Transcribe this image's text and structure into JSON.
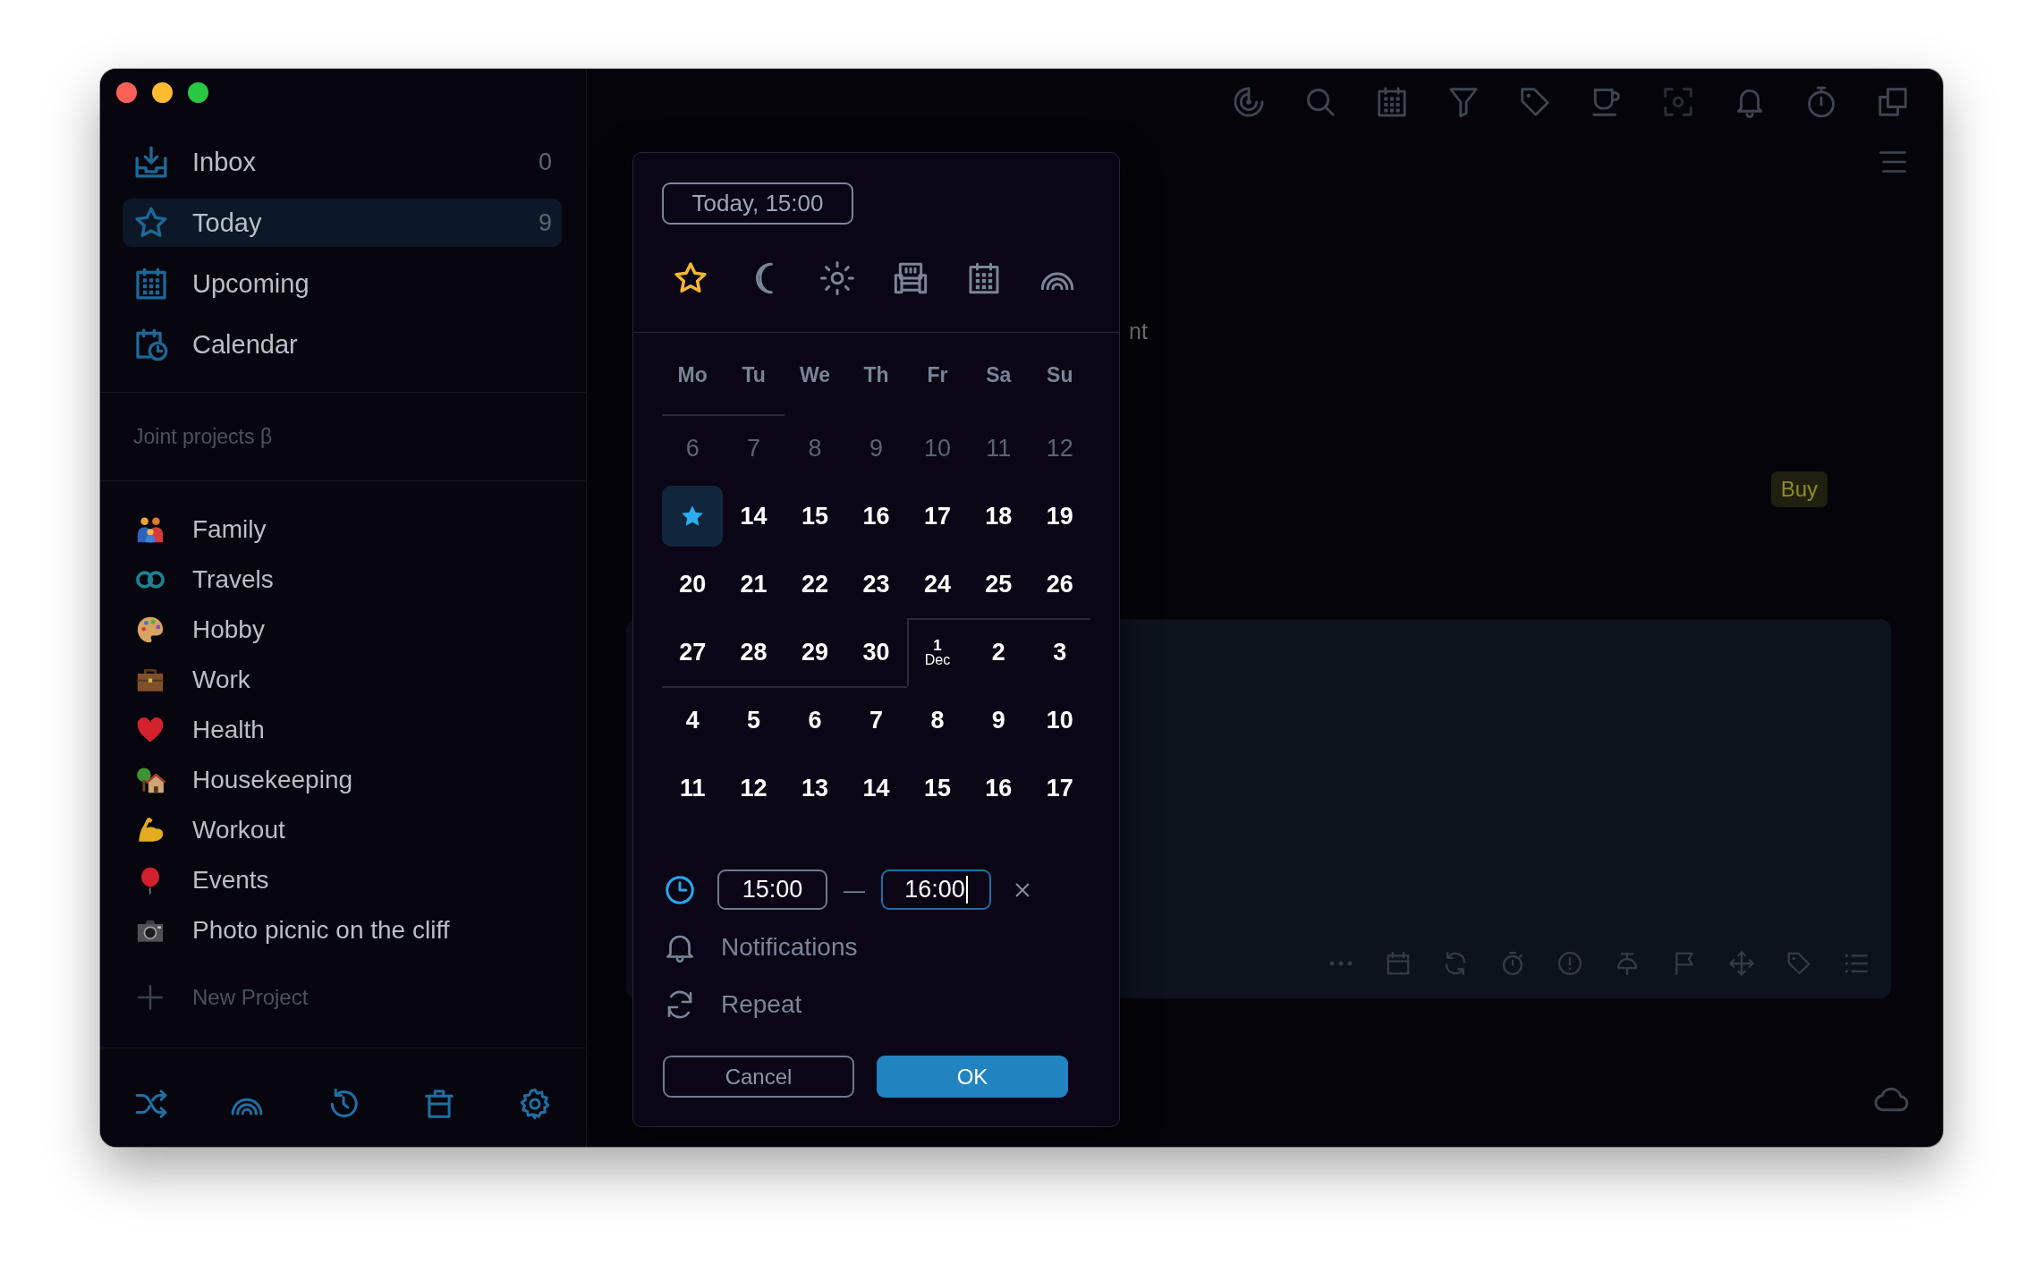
{
  "sidebar": {
    "nav": [
      {
        "label": "Inbox",
        "count": "0",
        "selected": false
      },
      {
        "label": "Today",
        "count": "9",
        "selected": true
      },
      {
        "label": "Upcoming",
        "selected": false
      },
      {
        "label": "Calendar",
        "selected": false
      }
    ],
    "section_title": "Joint projects β",
    "projects": [
      {
        "label": "Family"
      },
      {
        "label": "Travels"
      },
      {
        "label": "Hobby"
      },
      {
        "label": "Work"
      },
      {
        "label": "Health"
      },
      {
        "label": "Housekeeping"
      },
      {
        "label": "Workout"
      },
      {
        "label": "Events"
      },
      {
        "label": "Photo picnic on the cliff"
      }
    ],
    "new_project": "New Project"
  },
  "main": {
    "task_title_fragment": "nt",
    "tag": "Buy"
  },
  "date_popup": {
    "date_field": "Today, 15:00",
    "quick_picks": [
      {
        "kind": "star",
        "selected": true
      },
      {
        "kind": "moon",
        "selected": false
      },
      {
        "kind": "sun",
        "selected": false
      },
      {
        "kind": "armchair",
        "selected": false
      },
      {
        "kind": "calendar",
        "selected": false
      },
      {
        "kind": "rainbow",
        "selected": false
      }
    ],
    "weekdays": [
      "Mo",
      "Tu",
      "We",
      "Th",
      "Fr",
      "Sa",
      "Su"
    ],
    "weeks": [
      [
        {
          "kind": "day",
          "label": "6",
          "past": true,
          "selected": false
        },
        {
          "kind": "day",
          "label": "7",
          "past": true,
          "selected": false
        },
        {
          "kind": "day",
          "label": "8",
          "past": true,
          "selected": false
        },
        {
          "kind": "day",
          "label": "9",
          "past": true,
          "selected": false
        },
        {
          "kind": "day",
          "label": "10",
          "past": true,
          "selected": false
        },
        {
          "kind": "day",
          "label": "11",
          "past": true,
          "selected": false
        },
        {
          "kind": "day",
          "label": "12",
          "past": true,
          "selected": false
        }
      ],
      [
        {
          "kind": "today",
          "past": false,
          "selected": true
        },
        {
          "kind": "day",
          "label": "14",
          "past": false,
          "selected": false
        },
        {
          "kind": "day",
          "label": "15",
          "past": false,
          "selected": false
        },
        {
          "kind": "day",
          "label": "16",
          "past": false,
          "selected": false
        },
        {
          "kind": "day",
          "label": "17",
          "past": false,
          "selected": false
        },
        {
          "kind": "day",
          "label": "18",
          "past": false,
          "selected": false
        },
        {
          "kind": "day",
          "label": "19",
          "past": false,
          "selected": false
        }
      ],
      [
        {
          "kind": "day",
          "label": "20",
          "past": false,
          "selected": false
        },
        {
          "kind": "day",
          "label": "21",
          "past": false,
          "selected": false
        },
        {
          "kind": "day",
          "label": "22",
          "past": false,
          "selected": false
        },
        {
          "kind": "day",
          "label": "23",
          "past": false,
          "selected": false
        },
        {
          "kind": "day",
          "label": "24",
          "past": false,
          "selected": false
        },
        {
          "kind": "day",
          "label": "25",
          "past": false,
          "selected": false
        },
        {
          "kind": "day",
          "label": "26",
          "past": false,
          "selected": false
        }
      ],
      [
        {
          "kind": "day",
          "label": "27",
          "past": false,
          "selected": false
        },
        {
          "kind": "day",
          "label": "28",
          "past": false,
          "selected": false
        },
        {
          "kind": "day",
          "label": "29",
          "past": false,
          "selected": false
        },
        {
          "kind": "day",
          "label": "30",
          "past": false,
          "selected": false
        },
        {
          "kind": "month_start",
          "label": "1",
          "month": "Dec",
          "past": false,
          "selected": false
        },
        {
          "kind": "day",
          "label": "2",
          "past": false,
          "selected": false
        },
        {
          "kind": "day",
          "label": "3",
          "past": false,
          "selected": false
        }
      ],
      [
        {
          "kind": "day",
          "label": "4",
          "past": false,
          "selected": false
        },
        {
          "kind": "day",
          "label": "5",
          "past": false,
          "selected": false
        },
        {
          "kind": "day",
          "label": "6",
          "past": false,
          "selected": false
        },
        {
          "kind": "day",
          "label": "7",
          "past": false,
          "selected": false
        },
        {
          "kind": "day",
          "label": "8",
          "past": false,
          "selected": false
        },
        {
          "kind": "day",
          "label": "9",
          "past": false,
          "selected": false
        },
        {
          "kind": "day",
          "label": "10",
          "past": false,
          "selected": false
        }
      ],
      [
        {
          "kind": "day",
          "label": "11",
          "past": false,
          "selected": false
        },
        {
          "kind": "day",
          "label": "12",
          "past": false,
          "selected": false
        },
        {
          "kind": "day",
          "label": "13",
          "past": false,
          "selected": false
        },
        {
          "kind": "day",
          "label": "14",
          "past": false,
          "selected": false
        },
        {
          "kind": "day",
          "label": "15",
          "past": false,
          "selected": false
        },
        {
          "kind": "day",
          "label": "16",
          "past": false,
          "selected": false
        },
        {
          "kind": "day",
          "label": "17",
          "past": false,
          "selected": false
        }
      ]
    ],
    "time_fields": [
      {
        "value": "15:00",
        "focused": false
      },
      {
        "value": "16:00",
        "focused": true
      }
    ],
    "time_separator": "—",
    "options": [
      {
        "kind": "notifications",
        "label": "Notifications"
      },
      {
        "kind": "repeat",
        "label": "Repeat"
      }
    ],
    "buttons": [
      {
        "label": "Cancel",
        "kind": "secondary"
      },
      {
        "label": "OK",
        "kind": "primary"
      }
    ]
  }
}
